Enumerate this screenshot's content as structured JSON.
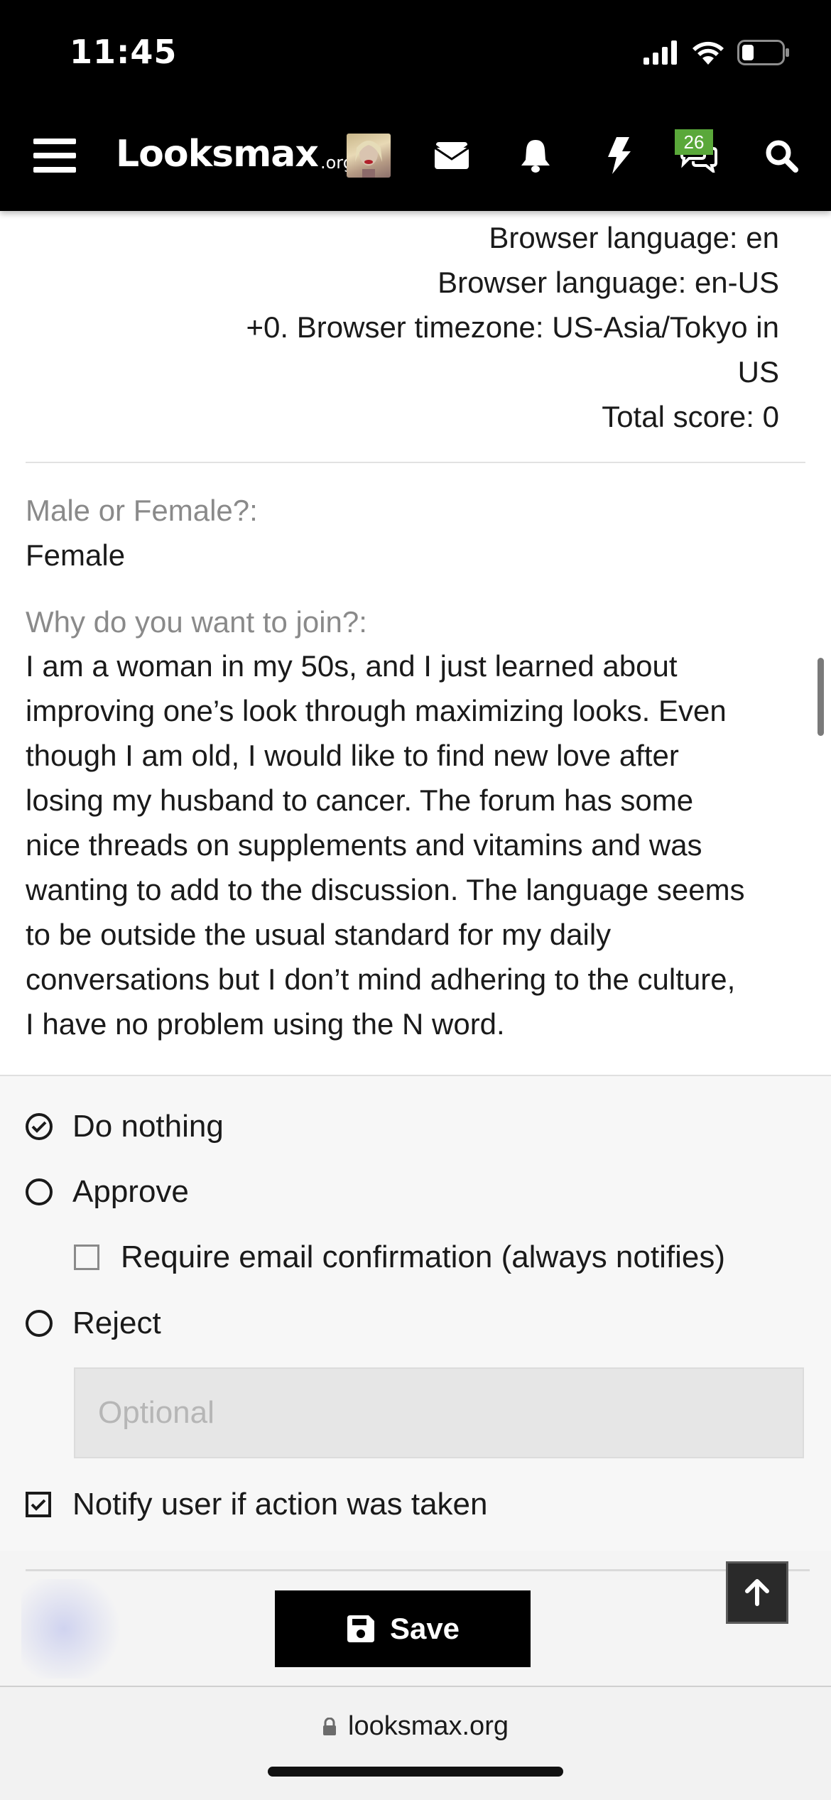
{
  "status_bar": {
    "time": "11:45"
  },
  "nav": {
    "logo_text": "Looksmax",
    "logo_suffix": ".org",
    "conversations_badge": "26",
    "icons": [
      "menu-icon",
      "avatar",
      "envelope-icon",
      "bell-icon",
      "bolt-icon",
      "chat-icon",
      "search-icon"
    ]
  },
  "info_lines": [
    "Browser language: en",
    "Browser language: en-US",
    "+0. Browser timezone: US-Asia/Tokyo in",
    "US",
    "Total score: 0"
  ],
  "fields": {
    "gender": {
      "label": "Male or Female?:",
      "value": "Female"
    },
    "join": {
      "label": "Why do you want to join?:",
      "lines": [
        "I am a woman in my 50s, and I just learned about",
        "improving one’s look through maximizing looks. Even",
        "though I am old, I would like to find new love after",
        "losing my husband to cancer. The forum has some",
        "nice threads on supplements and vitamins and was",
        "wanting to add to the discussion. The language seems",
        "to be outside the usual standard for my daily",
        "conversations but I don’t mind adhering to the culture,",
        "I have no problem using the N word."
      ]
    }
  },
  "actions": {
    "do_nothing": "Do nothing",
    "approve": "Approve",
    "require_email": "Require email confirmation (always notifies)",
    "reject": "Reject",
    "reason_placeholder": "Optional",
    "notify": "Notify user if action was taken",
    "selected": "Do nothing",
    "notify_checked": true,
    "require_email_checked": false
  },
  "footer": {
    "save_label": "Save"
  },
  "browser": {
    "url": "looksmax.org"
  }
}
